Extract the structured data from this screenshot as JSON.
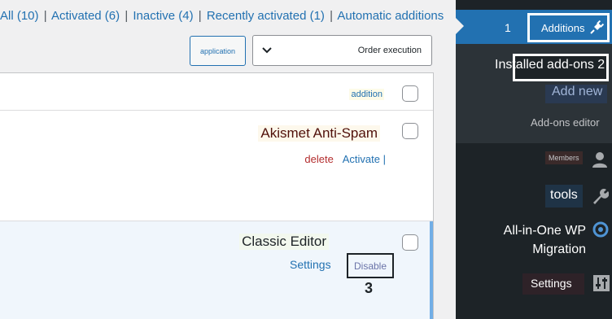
{
  "filters": {
    "all": "All (10)",
    "activated": "Activated (6)",
    "inactive": "Inactive (4)",
    "recently_activated": "Recently activated (1)",
    "automatic": "Automatic additions",
    "separator": "|"
  },
  "bulk": {
    "apply_label": "application",
    "selected_action": "Order execution"
  },
  "table": {
    "column_header": "addition",
    "plugins": [
      {
        "name": "Akismet Anti-Spam",
        "delete": "delete",
        "activate": "Activate",
        "pipe": "|"
      },
      {
        "name": "Classic Editor",
        "settings": "Settings",
        "disable": "Disable"
      }
    ]
  },
  "annotation": {
    "step": "3"
  },
  "sidebar": {
    "plugins_count": "1",
    "additions_label": "Additions",
    "installed_addons": "Installed add-ons 2",
    "add_new": "Add new",
    "addons_editor": "Add-ons editor",
    "members": "Members",
    "tools": "tools",
    "all_in_one_line1": "All-in-One WP",
    "all_in_one_line2": "Migration",
    "settings": "Settings"
  },
  "colors": {
    "accent": "#2271b1",
    "sidebar_bg": "#1d2327",
    "submenu_bg": "#2c3338",
    "delete_red": "#b32d2e",
    "active_row_bg": "#f0f6fc",
    "active_row_border": "#72aee6"
  },
  "icons": {
    "bulk_dropdown": "chevron-down-icon",
    "additions": "plugin-icon",
    "members": "user-icon",
    "tools": "wrench-icon",
    "migration": "refresh-icon",
    "settings": "sliders-icon"
  }
}
